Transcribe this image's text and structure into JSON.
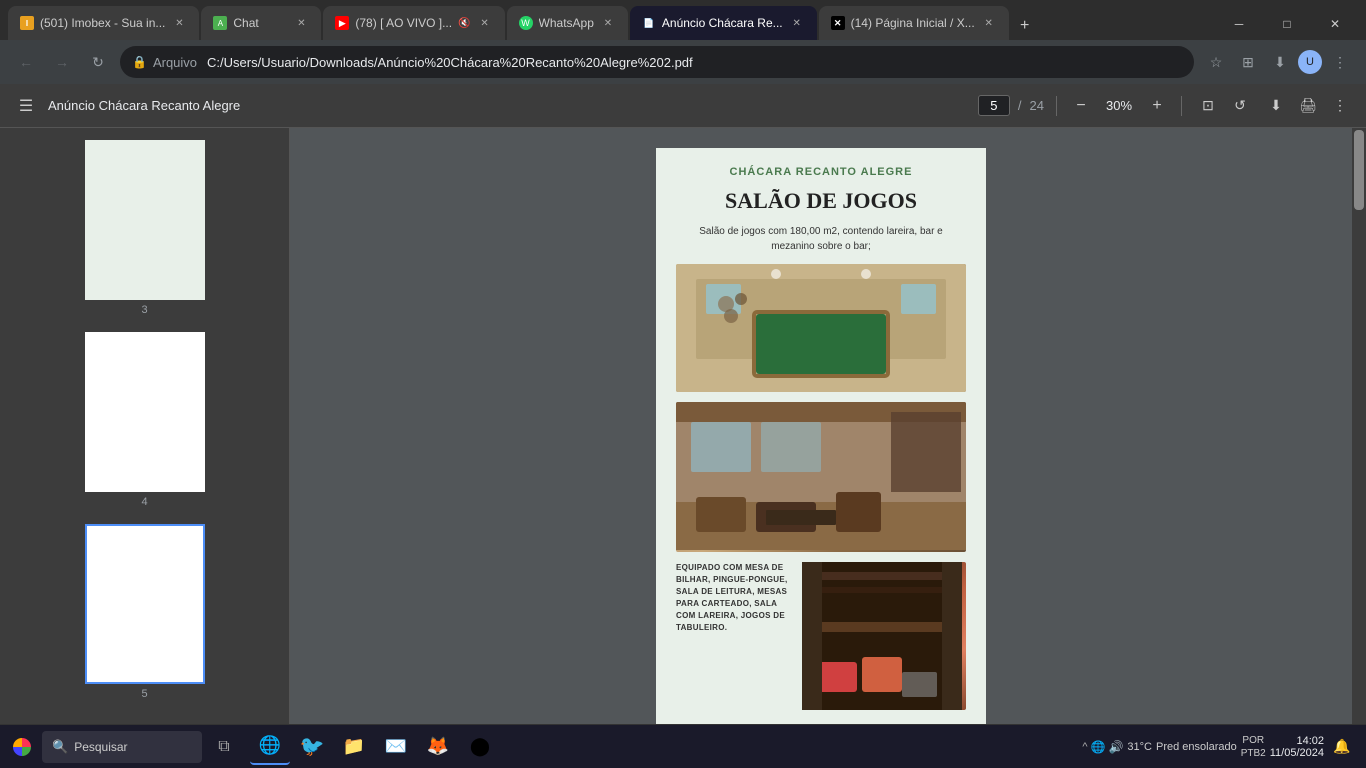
{
  "browser": {
    "tabs": [
      {
        "id": "imobex",
        "title": "(501) Imobex - Sua in...",
        "favicon": "I",
        "active": false,
        "muted": false
      },
      {
        "id": "chat",
        "title": "Chat",
        "favicon": "C",
        "active": false,
        "muted": false
      },
      {
        "id": "youtube",
        "title": "(78) [ AO VIVO ]...",
        "favicon": "▶",
        "active": false,
        "muted": true
      },
      {
        "id": "whatsapp",
        "title": "WhatsApp",
        "favicon": "W",
        "active": false,
        "muted": false
      },
      {
        "id": "pdf",
        "title": "Anúncio Chácara Re...",
        "favicon": "PDF",
        "active": true,
        "muted": false
      },
      {
        "id": "x",
        "title": "(14) Página Inicial / X...",
        "favicon": "X",
        "active": false,
        "muted": false
      }
    ],
    "address": {
      "label": "Arquivo",
      "url": "C:/Users/Usuario/Downloads/Anúncio%20Chácara%20Recanto%20Alegre%202.pdf"
    }
  },
  "pdf_viewer": {
    "title": "Anúncio Chácara Recanto Alegre",
    "current_page": "5",
    "total_pages": "24",
    "zoom": "30%",
    "thumbnail_pages": [
      "3",
      "4",
      "5"
    ]
  },
  "pdf_content": {
    "brand": "CHÁCARA RECANTO ALEGRE",
    "section_title": "SALÃO DE JOGOS",
    "description": "Salão de jogos com 180,00 m2, contendo lareira, bar e mezanino sobre o bar;",
    "bottom_text": "EQUIPADO COM MESA DE BILHAR, PINGUE-PONGUE, SALA DE LEITURA, MESAS PARA CARTEADO, SALA COM LAREIRA, JOGOS DE TABULEIRO."
  },
  "taskbar": {
    "search_placeholder": "Pesquisar",
    "weather": "31°C",
    "weather_desc": "Pred ensolarado",
    "time": "14:02",
    "date": "11/05/2024",
    "language": "POR",
    "keyboard": "PTB2"
  }
}
